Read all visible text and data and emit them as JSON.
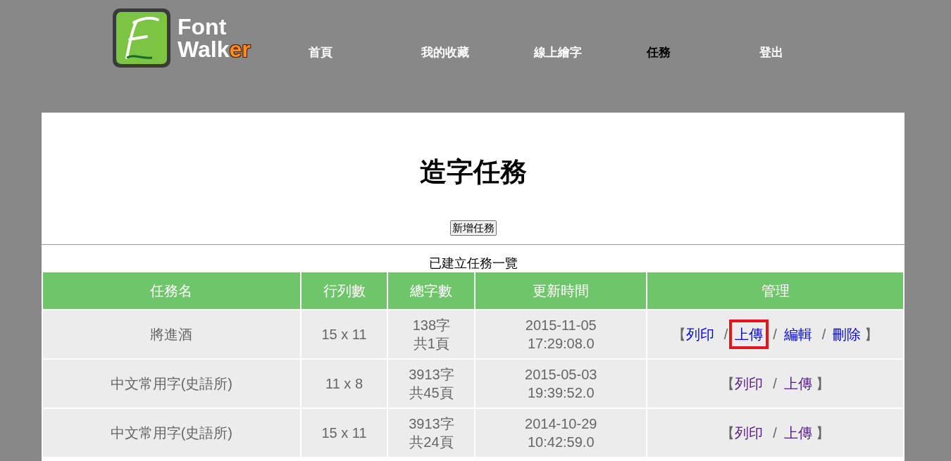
{
  "logo": {
    "line1": "Font",
    "line2": "Walk",
    "line2_accent": "er"
  },
  "nav": [
    {
      "label": "首頁",
      "selected": false
    },
    {
      "label": "我的收藏",
      "selected": false
    },
    {
      "label": "線上繪字",
      "selected": false
    },
    {
      "label": "任務",
      "selected": true
    },
    {
      "label": "登出",
      "selected": false
    }
  ],
  "page_title": "造字任務",
  "add_button": "新增任務",
  "table": {
    "caption": "已建立任務一覽",
    "columns": [
      "任務名",
      "行列數",
      "總字數",
      "更新時間",
      "管理"
    ],
    "rows": [
      {
        "name": "將進酒",
        "grid": "15 x 11",
        "count": [
          "138字",
          "共1頁"
        ],
        "updated": [
          "2015-11-05",
          "17:29:08.0"
        ],
        "open": "【",
        "close": "】",
        "links": [
          {
            "label": "列印",
            "visited": false,
            "highlighted": false,
            "after": "/"
          },
          {
            "label": "上傳",
            "visited": false,
            "highlighted": true,
            "after": "/"
          },
          {
            "label": "編輯",
            "visited": false,
            "highlighted": false,
            "after": "/"
          },
          {
            "label": "刪除",
            "visited": false,
            "highlighted": false
          }
        ]
      },
      {
        "name": "中文常用字(史語所)",
        "grid": "11 x 8",
        "count": [
          "3913字",
          "共45頁"
        ],
        "updated": [
          "2015-05-03",
          "19:39:52.0"
        ],
        "open": "【",
        "close": "】",
        "links": [
          {
            "label": "列印",
            "visited": true,
            "highlighted": false,
            "after": "/"
          },
          {
            "label": "上傳",
            "visited": true,
            "highlighted": false
          }
        ]
      },
      {
        "name": "中文常用字(史語所)",
        "grid": "15 x 11",
        "count": [
          "3913字",
          "共24頁"
        ],
        "updated": [
          "2014-10-29",
          "10:42:59.0"
        ],
        "open": "【",
        "close": "】",
        "links": [
          {
            "label": "列印",
            "visited": true,
            "highlighted": false,
            "after": "/"
          },
          {
            "label": "上傳",
            "visited": true,
            "highlighted": false
          }
        ]
      }
    ]
  }
}
